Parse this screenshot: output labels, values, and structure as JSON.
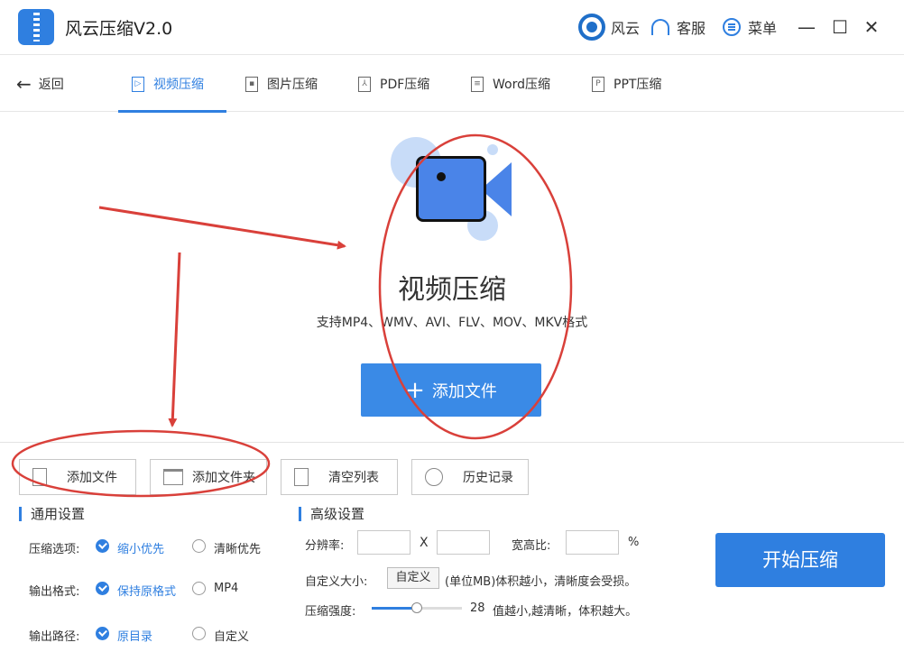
{
  "app": {
    "title": "风云压缩V2.0"
  },
  "topbar": {
    "brand_label": "风云",
    "service_label": "客服",
    "menu_label": "菜单",
    "minimize": "—",
    "maximize": "☐",
    "close": "✕"
  },
  "nav": {
    "back_label": "返回",
    "tabs": [
      {
        "label": "视频压缩",
        "icon": "play-doc-icon",
        "glyph": "▷",
        "active": true
      },
      {
        "label": "图片压缩",
        "icon": "image-doc-icon",
        "glyph": "▪",
        "active": false
      },
      {
        "label": "PDF压缩",
        "icon": "pdf-doc-icon",
        "glyph": "⅄",
        "active": false
      },
      {
        "label": "Word压缩",
        "icon": "word-doc-icon",
        "glyph": "≡",
        "active": false
      },
      {
        "label": "PPT压缩",
        "icon": "ppt-doc-icon",
        "glyph": "P",
        "active": false
      }
    ]
  },
  "hero": {
    "title": "视频压缩",
    "subtitle": "支持MP4、WMV、AVI、FLV、MOV、MKV格式",
    "add_label": "添加文件",
    "plus": "+"
  },
  "toolbar": {
    "add_file": "添加文件",
    "add_folder": "添加文件夹",
    "clear_list": "清空列表",
    "history": "历史记录"
  },
  "general": {
    "title": "通用设置",
    "compress_label": "压缩选项:",
    "compress_opt1": "缩小优先",
    "compress_opt2": "清晰优先",
    "format_label": "输出格式:",
    "format_opt1": "保持原格式",
    "format_opt2": "MP4",
    "path_label": "输出路径:",
    "path_opt1": "原目录",
    "path_opt2": "自定义"
  },
  "advanced": {
    "title": "高级设置",
    "resolution_label": "分辨率:",
    "x_sep": "X",
    "ratio_label": "宽高比:",
    "percent": "%",
    "custom_size_label": "自定义大小:",
    "custom_button": "自定义",
    "custom_hint": "(单位MB)体积越小，清晰度会受损。",
    "strength_label": "压缩强度:",
    "strength_value": "28",
    "strength_fraction": 0.5,
    "strength_hint": "值越小,越清晰，体积越大。"
  },
  "start_label": "开始压缩",
  "colors": {
    "accent": "#2f7fe0",
    "annotation": "#d9403a"
  }
}
